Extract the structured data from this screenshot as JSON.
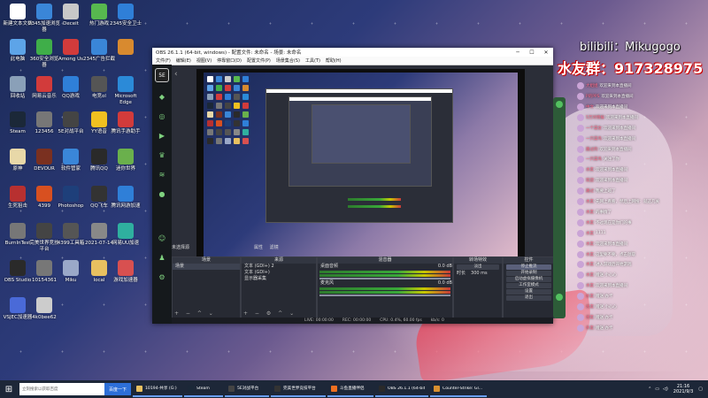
{
  "colors": {
    "accent": "#6aa0ff",
    "obs_green": "#53c160",
    "chat_name": "#ff6b8b",
    "taskbar": "#1d2738"
  },
  "desktop_icons": [
    {
      "label": "新建文本文档",
      "icon": "text-file-icon",
      "color": "#ffffff"
    },
    {
      "label": "2345加速浏览器",
      "icon": "browser-icon",
      "color": "#3a86d8"
    },
    {
      "label": "Deceit",
      "icon": "deceit-icon",
      "color": "#c8c8c8"
    },
    {
      "label": "热门游戏",
      "icon": "game-icon",
      "color": "#57b84f"
    },
    {
      "label": "2345安全卫士",
      "icon": "shield-icon",
      "color": "#2f7fd8"
    },
    {
      "label": "此电脑",
      "icon": "computer-icon",
      "color": "#5da4e8"
    },
    {
      "label": "360安全浏览器",
      "icon": "browser-icon",
      "color": "#3fae49"
    },
    {
      "label": "Among Us",
      "icon": "among-us-icon",
      "color": "#d23b3b"
    },
    {
      "label": "2345广告拦截",
      "icon": "adblock-icon",
      "color": "#3a86d8"
    },
    {
      "label": "",
      "icon": "game-icon",
      "color": "#d88a2f"
    },
    {
      "label": "回收站",
      "icon": "recycle-bin-icon",
      "color": "#8aa0b8"
    },
    {
      "label": "网易云音乐",
      "icon": "music-icon",
      "color": "#d23b3b"
    },
    {
      "label": "QQ游戏",
      "icon": "qq-game-icon",
      "color": "#2f7fd8"
    },
    {
      "label": "电竞ol",
      "icon": "game-icon",
      "color": "#555555"
    },
    {
      "label": "Microsoft Edge",
      "icon": "edge-icon",
      "color": "#2b8ad8"
    },
    {
      "label": "Steam",
      "icon": "steam-icon",
      "color": "#1b2838"
    },
    {
      "label": "123456",
      "icon": "image-icon",
      "color": "#777777"
    },
    {
      "label": "5E对战平台",
      "icon": "5e-icon",
      "color": "#444444"
    },
    {
      "label": "YY语音",
      "icon": "yy-icon",
      "color": "#f0c020"
    },
    {
      "label": "腾讯手游助手",
      "icon": "tencent-icon",
      "color": "#d23b3b"
    },
    {
      "label": "原神",
      "icon": "genshin-icon",
      "color": "#e8d8a8"
    },
    {
      "label": "DEVOUR",
      "icon": "devour-icon",
      "color": "#7a3020"
    },
    {
      "label": "软件管家",
      "icon": "software-icon",
      "color": "#3a86d8"
    },
    {
      "label": "腾讯QQ",
      "icon": "qq-icon",
      "color": "#2a2a2a"
    },
    {
      "label": "迷你世界",
      "icon": "game-icon",
      "color": "#6ab04c"
    },
    {
      "label": "生死狙击",
      "icon": "game-icon",
      "color": "#b83030"
    },
    {
      "label": "4399",
      "icon": "game-icon",
      "color": "#d85020"
    },
    {
      "label": "Photoshop",
      "icon": "photoshop-icon",
      "color": "#1e3f7a"
    },
    {
      "label": "QQ飞车",
      "icon": "qq-speed-icon",
      "color": "#333333"
    },
    {
      "label": "腾讯网游加速",
      "icon": "accelerator-icon",
      "color": "#2f7fd8"
    },
    {
      "label": "BurnInTest",
      "icon": "test-icon",
      "color": "#777777"
    },
    {
      "label": "完美世界竞技平台",
      "icon": "perfect-world-icon",
      "color": "#444444"
    },
    {
      "label": "4399工具箱",
      "icon": "toolbox-icon",
      "color": "#555555"
    },
    {
      "label": "2021-07-14",
      "icon": "image-icon",
      "color": "#888888"
    },
    {
      "label": "网易UU加速",
      "icon": "uu-icon",
      "color": "#2faf9f"
    },
    {
      "label": "OBS Studio",
      "icon": "obs-icon",
      "color": "#2a2a2a"
    },
    {
      "label": "10154361",
      "icon": "image-icon",
      "color": "#777777"
    },
    {
      "label": "Miku",
      "icon": "image-icon",
      "color": "#9aa8c8"
    },
    {
      "label": "local",
      "icon": "folder-icon",
      "color": "#e8c060"
    },
    {
      "label": "游戏加速器",
      "icon": "accelerator-icon",
      "color": "#d85050"
    },
    {
      "label": "VSJEC加速器",
      "icon": "accelerator-icon",
      "color": "#4a6ad8"
    },
    {
      "label": "4k0bee62",
      "icon": "image-icon",
      "color": "#cccccc"
    }
  ],
  "obs": {
    "title": "OBS 26.1.1 (64-bit, windows) - 配置文件: 未命名 - 场景: 未命名",
    "menu": [
      "文件(F)",
      "编辑(E)",
      "视图(V)",
      "停靠窗口(D)",
      "配置文件(P)",
      "场景集合(S)",
      "工具(T)",
      "帮助(H)"
    ],
    "status_title": "未选择源",
    "props_label": "属性",
    "filters_label": "滤镜",
    "scenes_header": "场景",
    "scenes": [
      "场景"
    ],
    "sources_header": "来源",
    "sources": [
      "文本 (GDI+) 2",
      "文本 (GDI+)",
      "显示器采集"
    ],
    "mixer_header": "混音器",
    "mixer_tracks": [
      {
        "name": "桌面音频",
        "db": "0.0 dB"
      },
      {
        "name": "麦克风",
        "db": "0.0 dB"
      }
    ],
    "transition_header": "转场特效",
    "transition_type": "淡出",
    "duration_label": "时长",
    "duration_value": "300 ms",
    "controls_header": "控件",
    "controls": [
      "停止推流",
      "开始录制",
      "启动虚拟摄像机",
      "工作室模式",
      "设置",
      "退出"
    ],
    "status": {
      "live": "LIVE: 00:00:00",
      "rec": "REC: 00:00:00",
      "cpu": "CPU: 0.4%, 60.00 fps",
      "kbps": "kb/s: 0"
    }
  },
  "overlay": {
    "bili": "bilibili：Mikugogo",
    "qq": "水友群：917328975"
  },
  "chat": [
    {
      "name": "大姐姐",
      "msg": "欢迎来到本直播间"
    },
    {
      "name": "P的PPS",
      "msg": "欢迎来到本直播间"
    },
    {
      "name": "中文",
      "msg": "欢迎来到本直播间"
    },
    {
      "name": "5万对情报",
      "msg": "欢迎来到本直播间"
    },
    {
      "name": "一个菜女",
      "msg": "欢迎来到本直播间"
    },
    {
      "name": "一只菜鸟",
      "msg": "欢迎来到本直播间"
    },
    {
      "name": "路过的",
      "msg": "欢迎来到本直播间"
    },
    {
      "name": "一只菜鸟",
      "msg": "关注了你"
    },
    {
      "name": "水友",
      "msg": "欢迎来到本直播间"
    },
    {
      "name": "欢迎",
      "msg": "欢迎来到本直播间"
    },
    {
      "name": "路过",
      "msg": "我要上班了"
    },
    {
      "name": "水友",
      "msg": "先网上看看，然后上网搜：就这几关"
    },
    {
      "name": "水友",
      "msg": "的事情了"
    },
    {
      "name": "水友",
      "msg": "不过现在是你们的事"
    },
    {
      "name": "水友",
      "msg": "1111"
    },
    {
      "name": "水友",
      "msg": "欢迎来到本直播间"
    },
    {
      "name": "水友",
      "msg": "这里要不要，点击领取"
    },
    {
      "name": "水友",
      "msg": "进入游戏后开始游戏"
    },
    {
      "name": "水友",
      "msg": "赠送 小心心"
    },
    {
      "name": "水友",
      "msg": "欢迎来到本直播间"
    },
    {
      "name": "水友",
      "msg": "赠送 办卡"
    },
    {
      "name": "水友",
      "msg": "赠送 小心心"
    },
    {
      "name": "水友",
      "msg": "赠送 办卡"
    },
    {
      "name": "水友",
      "msg": "赠送 办卡"
    }
  ],
  "taskbar": {
    "search_placeholder": "立刻搜索以获取百度",
    "search_button": "百度一下",
    "apps": [
      {
        "label": "10194-共享 (G:)",
        "color": "#e8c060"
      },
      {
        "label": "Steam",
        "color": "#1b2838"
      },
      {
        "label": "5E对战平台",
        "color": "#444444"
      },
      {
        "label": "完美世界竞技平台",
        "color": "#333333"
      },
      {
        "label": "斗鱼直播伴侣",
        "color": "#f07020"
      },
      {
        "label": "OBS 26.1.1 (64-bit...)",
        "color": "#2a2a2a"
      },
      {
        "label": "Counter-Strike: Gl...",
        "color": "#d89030"
      }
    ],
    "time": "21:16",
    "date": "2021/9/3"
  }
}
